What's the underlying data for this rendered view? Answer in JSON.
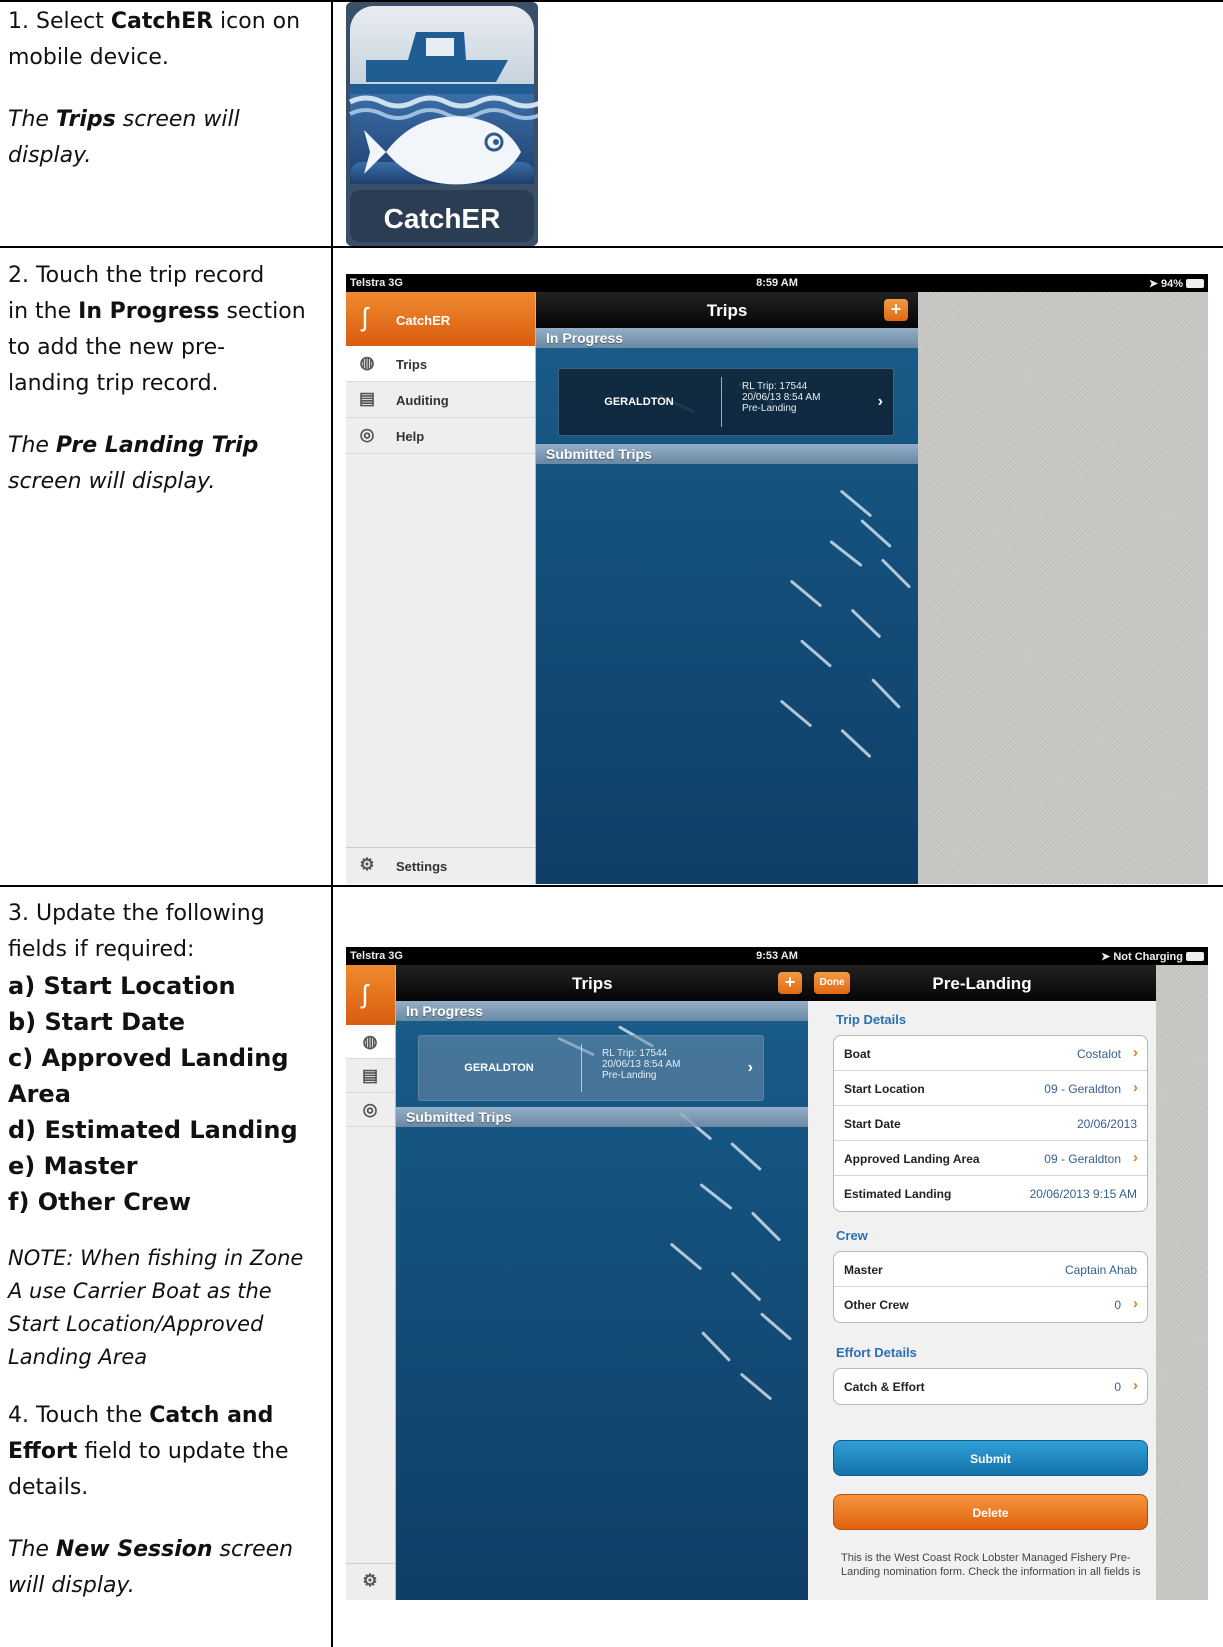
{
  "rows": [
    {
      "step1_prefix": "1. Select ",
      "step1_bold": "CatchER",
      "step1_suffix": " icon on",
      "step1_line2": "mobile device.",
      "result_prefix": "The ",
      "result_bold": "Trips",
      "result_suffix": " screen will",
      "result_line2": "display."
    },
    {
      "l1": "2. Touch the trip record",
      "l2_prefix": "in the ",
      "l2_bold": "In Progress",
      "l2_suffix": " section",
      "l3": "to add the new pre-",
      "l4": "landing trip record.",
      "result_prefix": "The ",
      "result_bold": "Pre Landing Trip",
      "result_line2": "screen will display."
    },
    {
      "l1": "3. Update the following",
      "l2": "fields if required:",
      "fields": [
        "a) Start Location",
        "b) Start Date",
        "c) Approved Landing",
        "Area",
        "d) Estimated Landing",
        "e) Master",
        "f) Other Crew"
      ],
      "note_lines": [
        "NOTE: When fishing in Zone",
        "A use Carrier Boat as the",
        "Start Location/Approved",
        "Landing Area"
      ],
      "s4_prefix": "4. Touch the ",
      "s4_bold1": "Catch and",
      "s4_bold2": "Effort",
      "s4_suffix": " field to update the",
      "s4_line3": "details.",
      "result_prefix": "The ",
      "result_bold": "New Session",
      "result_suffix": " screen",
      "result_line2": "will display."
    }
  ],
  "app_icon": {
    "label": "CatchER"
  },
  "screen1": {
    "carrier": "Telstra  3G",
    "time": "8:59 AM",
    "battery": "94%",
    "sidebar": {
      "app_name": "CatchER",
      "items": [
        "Trips",
        "Auditing",
        "Help"
      ],
      "settings": "Settings"
    },
    "nav_title": "Trips",
    "in_progress": "In Progress",
    "submitted": "Submitted Trips",
    "trip": {
      "location": "GERALDTON",
      "trip_no": "RL Trip: 17544",
      "datetime": "20/06/13 8:54 AM",
      "status": "Pre-Landing"
    }
  },
  "screen2": {
    "carrier": "Telstra  3G",
    "time": "9:53 AM",
    "battery": "Not Charging",
    "nav_left": "Trips",
    "nav_right": "Pre-Landing",
    "done": "Done",
    "in_progress": "In Progress",
    "submitted": "Submitted Trips",
    "trip": {
      "location": "GERALDTON",
      "trip_no": "RL Trip: 17544",
      "datetime": "20/06/13 8:54 AM",
      "status": "Pre-Landing"
    },
    "trip_details_title": "Trip Details",
    "trip_details": [
      {
        "k": "Boat",
        "v": "Costalot",
        "chev": true
      },
      {
        "k": "Start Location",
        "v": "09 - Geraldton",
        "chev": true
      },
      {
        "k": "Start Date",
        "v": "20/06/2013",
        "chev": false
      },
      {
        "k": "Approved Landing Area",
        "v": "09 - Geraldton",
        "chev": true
      },
      {
        "k": "Estimated Landing",
        "v": "20/06/2013 9:15 AM",
        "chev": false
      }
    ],
    "crew_title": "Crew",
    "crew": [
      {
        "k": "Master",
        "v": "Captain Ahab",
        "chev": false
      },
      {
        "k": "Other Crew",
        "v": "0",
        "chev": true
      }
    ],
    "effort_title": "Effort Details",
    "effort": [
      {
        "k": "Catch & Effort",
        "v": "0",
        "chev": true
      }
    ],
    "submit": "Submit",
    "delete": "Delete",
    "footnote": "This is the West Coast Rock Lobster Managed Fishery Pre-Landing nomination form. Check the information in all fields is"
  },
  "colors": {
    "accent_orange": "#e8761e",
    "link_blue": "#2d6fb3",
    "sea_blue": "#14507c"
  }
}
